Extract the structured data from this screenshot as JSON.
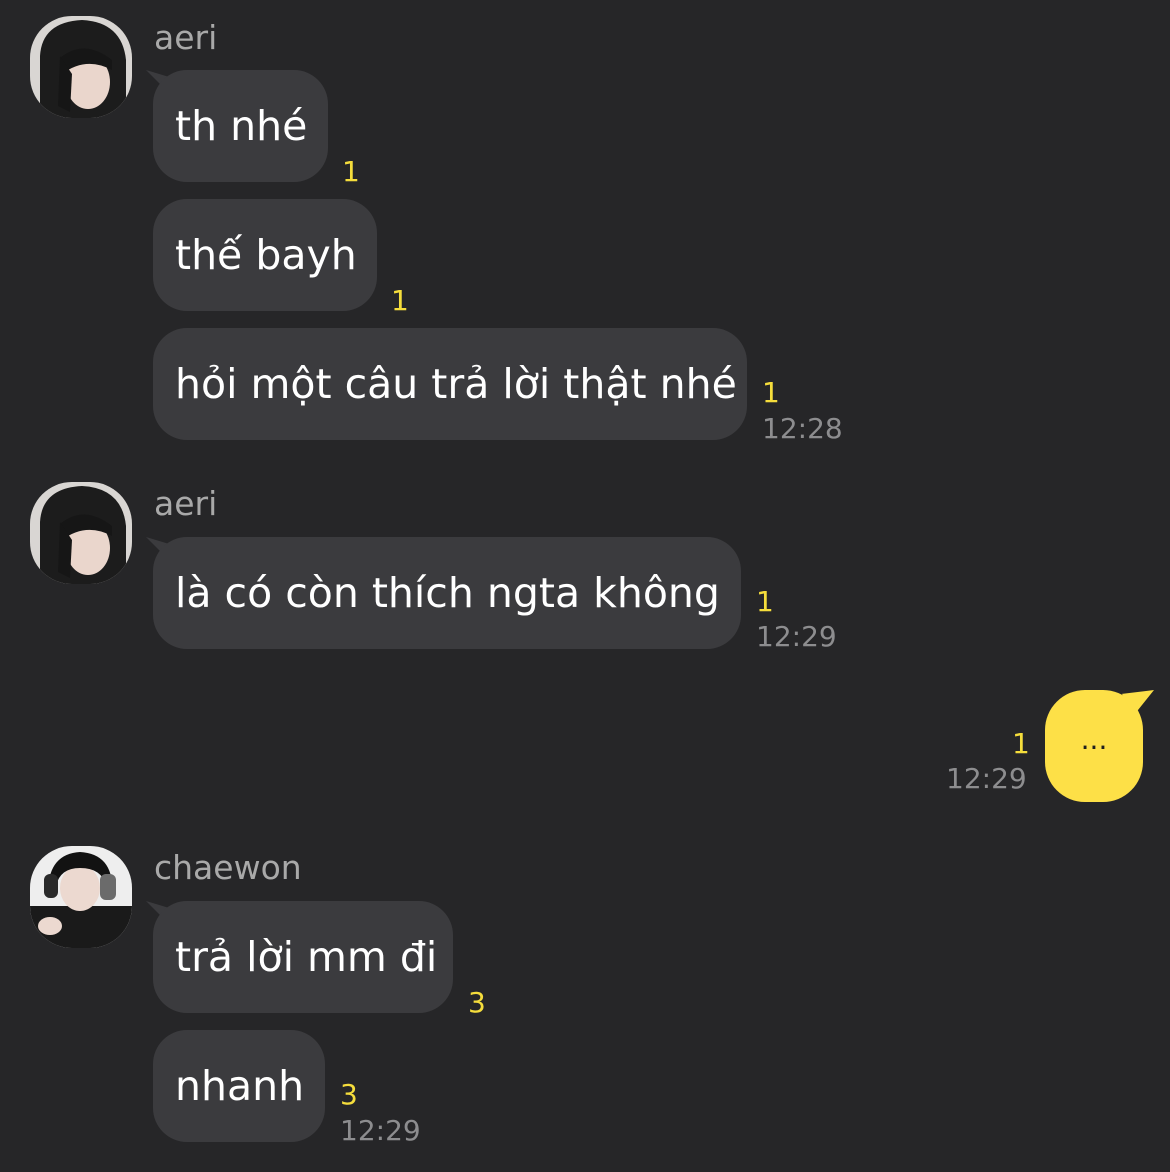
{
  "groups": [
    {
      "sender": "aeri",
      "avatar": "aeri-avatar-photo",
      "messages": [
        {
          "text": "th nhé",
          "unread": "1",
          "time": ""
        },
        {
          "text": "thế bayh",
          "unread": "1",
          "time": ""
        },
        {
          "text": "hỏi một câu trả lời thật nhé",
          "unread": "1",
          "time": "12:28"
        }
      ]
    },
    {
      "sender": "aeri",
      "avatar": "aeri-avatar-photo",
      "messages": [
        {
          "text": "là có còn thích ngta không",
          "unread": "1",
          "time": "12:29"
        }
      ]
    },
    {
      "sender": "me",
      "messages": [
        {
          "text": "...",
          "unread": "1",
          "time": "12:29"
        }
      ]
    },
    {
      "sender": "chaewon",
      "avatar": "chaewon-avatar-photo",
      "messages": [
        {
          "text": "trả lời mm đi",
          "unread": "3",
          "time": ""
        },
        {
          "text": "nhanh",
          "unread": "3",
          "time": "12:29"
        }
      ]
    }
  ],
  "colors": {
    "background": "#262628",
    "bubble_other": "#3b3b3e",
    "bubble_mine": "#fde047",
    "unread_count": "#f5dd3c",
    "timestamp": "#8d8d8f",
    "sender_name": "#a9a9a9"
  }
}
